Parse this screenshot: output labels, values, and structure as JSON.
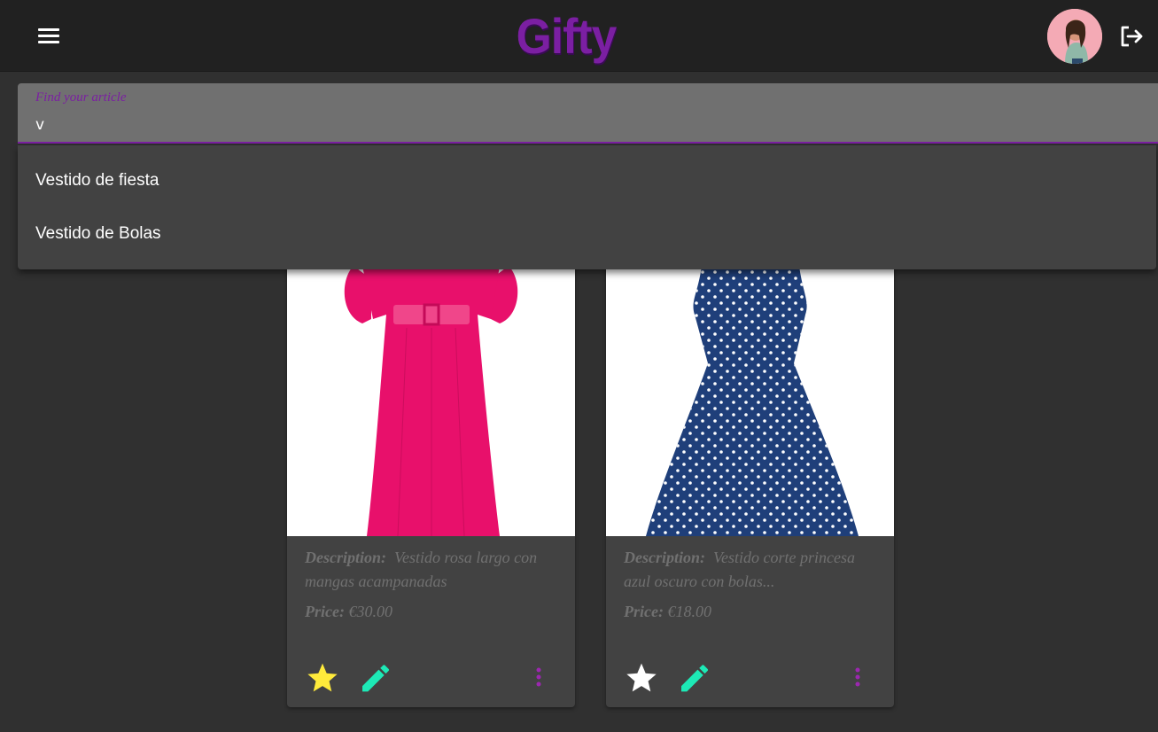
{
  "app": {
    "logo": "Gifty"
  },
  "search": {
    "label": "Find your article",
    "value": "v"
  },
  "suggestions": [
    "Vestido de fiesta",
    "Vestido de Bolas"
  ],
  "products": [
    {
      "description_label": "Description:",
      "description": "Vestido rosa largo con mangas acampanadas",
      "price_label": "Price:",
      "price": "€30.00",
      "favorite": true,
      "dress_color": "#e8106b"
    },
    {
      "description_label": "Description:",
      "description": "Vestido corte princesa azul oscuro con bolas...",
      "price_label": "Price:",
      "price": "€18.00",
      "favorite": false,
      "dress_color": "#1f3f7a"
    }
  ],
  "colors": {
    "brand": "#7b1fa2",
    "accent_green": "#1de9b6",
    "star_favorite": "#ffeb3b",
    "more_menu": "#9c27b0"
  },
  "icons": {
    "menu": "menu-icon",
    "logout": "logout-icon",
    "star": "star-icon",
    "edit": "edit-icon",
    "more": "more-vert-icon"
  }
}
